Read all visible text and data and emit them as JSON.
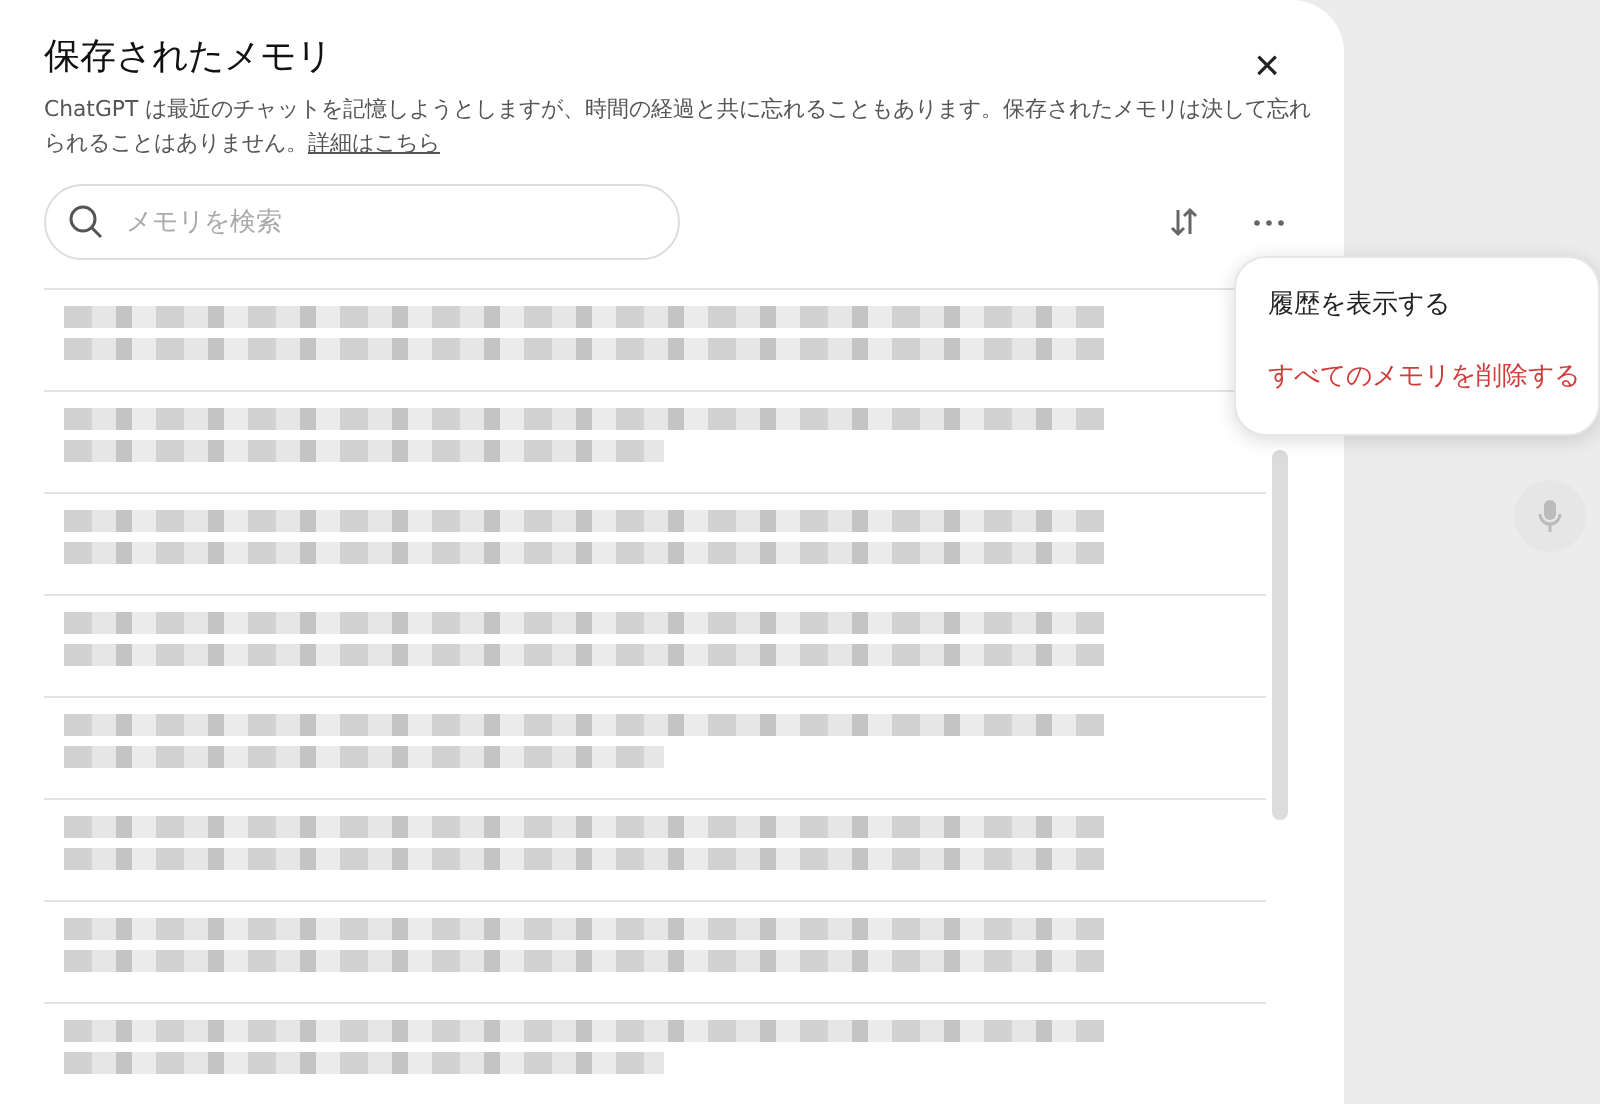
{
  "dialog": {
    "title": "保存されたメモリ",
    "description": "ChatGPT は最近のチャットを記憶しようとしますが、時間の経過と共に忘れることもあります。保存されたメモリは決して忘れられることはありません。",
    "link": "詳細はこちら",
    "close": "×"
  },
  "search": {
    "placeholder": "メモリを検索"
  },
  "memories": [
    {
      "kind": "redacted"
    },
    {
      "kind": "redacted"
    },
    {
      "kind": "redacted"
    },
    {
      "kind": "redacted"
    },
    {
      "kind": "redacted"
    },
    {
      "kind": "redacted"
    },
    {
      "kind": "redacted"
    },
    {
      "kind": "redacted"
    }
  ],
  "menu": {
    "items": [
      {
        "label": "履歴を表示する",
        "kind": "normal"
      },
      {
        "label": "すべてのメモリを削除する",
        "kind": "danger"
      }
    ]
  }
}
